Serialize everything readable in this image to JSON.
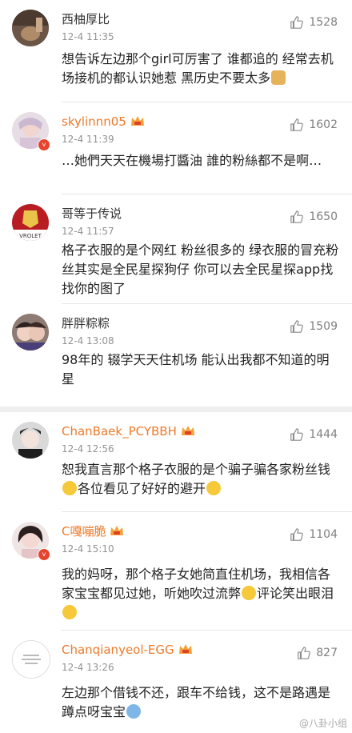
{
  "comments": [
    {
      "user": "西柚厚比",
      "time": "12-4 11:35",
      "likes": "1528",
      "text": "想告诉左边那个girl可厉害了 谁都追的 经常去机场接机的都认识她惹 黑历史不要太多"
    },
    {
      "user": "skylinnn05",
      "time": "12-4 11:39",
      "likes": "1602",
      "text": "…她們天天在機場打醬油 誰的粉絲都不是啊…"
    },
    {
      "user": "哥等于传说",
      "time": "12-4 11:57",
      "likes": "1650",
      "avatar_text": "VROLET",
      "text": "格子衣服的是个网红 粉丝很多的 绿衣服的冒充粉丝其实是全民星探狗仔 你可以去全民星探app找找你的图了"
    },
    {
      "user": "胖胖粽粽",
      "time": "12-4 13:08",
      "likes": "1509",
      "text": "98年的 辍学天天住机场 能认出我都不知道的明星"
    },
    {
      "user": "ChanBaek_PCYBBH",
      "time": "12-4 12:56",
      "likes": "1444",
      "text_a": "恕我直言那个格子衣服的是个骗子骗各家粉丝钱",
      "text_b": "各位看见了好好的避开"
    },
    {
      "user": "C嘎嘣脆",
      "time": "12-4 15:10",
      "likes": "1104",
      "text_a": "我的妈呀，那个格子女她简直住机场，我相信各家宝宝都见过她，听她吹过流弊",
      "text_b": "评论笑出眼泪"
    },
    {
      "user": "Chanqianyeol-EGG",
      "time": "12-4 13:26",
      "likes": "827",
      "text": "左边那个借钱不还，跟车不给钱，这不是路遇是蹲点呀宝宝"
    }
  ],
  "watermark": "@八卦小组"
}
